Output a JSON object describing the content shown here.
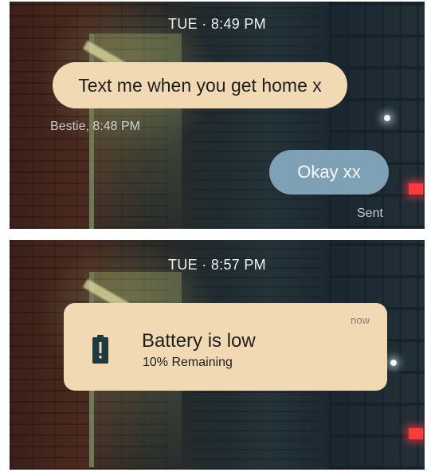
{
  "top_screen": {
    "time": "TUE · 8:49 PM",
    "incoming_message": "Text me when you get home x",
    "incoming_meta": "Bestie, 8:48 PM",
    "outgoing_message": "Okay xx",
    "outgoing_status": "Sent"
  },
  "bottom_screen": {
    "time": "TUE · 8:57 PM",
    "notification": {
      "title": "Battery is low",
      "subtitle": "10% Remaining",
      "timestamp": "now",
      "icon": "battery-alert-icon"
    }
  },
  "colors": {
    "bubble_incoming": "#f1d9b4",
    "bubble_outgoing": "#7fa1b6",
    "notification_bg": "#f1d9b4"
  }
}
